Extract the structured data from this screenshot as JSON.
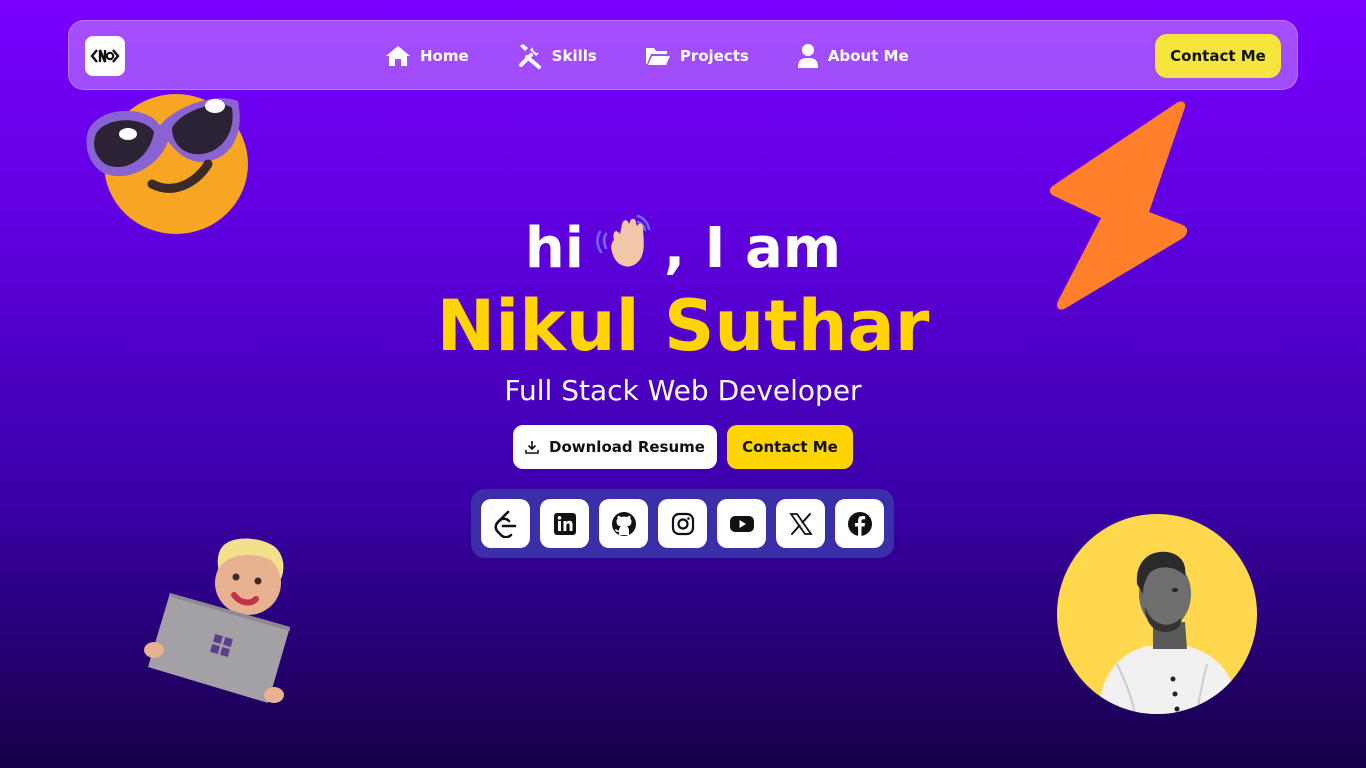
{
  "nav": {
    "links": [
      {
        "label": "Home",
        "icon": "home-icon"
      },
      {
        "label": "Skills",
        "icon": "tools-icon"
      },
      {
        "label": "Projects",
        "icon": "folder-icon"
      },
      {
        "label": "About Me",
        "icon": "user-icon"
      }
    ],
    "contact_label": "Contact Me"
  },
  "hero": {
    "greeting_pre": "hi",
    "greeting_post": ", I am",
    "name": "Nikul Suthar",
    "role": "Full Stack Web Developer",
    "resume_label": "Download Resume",
    "contact_label": "Contact Me"
  },
  "socials": [
    {
      "icon": "leetcode-icon"
    },
    {
      "icon": "linkedin-icon"
    },
    {
      "icon": "github-icon"
    },
    {
      "icon": "instagram-icon"
    },
    {
      "icon": "youtube-icon"
    },
    {
      "icon": "x-icon"
    },
    {
      "icon": "facebook-icon"
    }
  ],
  "colors": {
    "accent_yellow": "#ffd400",
    "nav_button_yellow": "#f5e53c",
    "bg_top": "#7a00ff",
    "bg_bottom": "#160048",
    "social_panel": "#3a2fa8"
  }
}
